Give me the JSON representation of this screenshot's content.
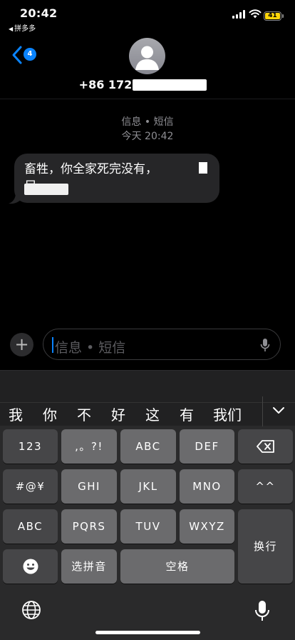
{
  "status_bar": {
    "time": "20:42",
    "back_app": "拼多多",
    "battery_level": "41",
    "battery_color": "#ffd60a"
  },
  "header": {
    "back_badge_count": "4",
    "contact_name": "+86 172"
  },
  "conversation": {
    "service_label": "信息 • 短信",
    "timestamp": "今天 20:42",
    "messages": [
      {
        "direction": "incoming",
        "text_line1": "畜牲，你全家死完没有，",
        "text_line2": "尸"
      }
    ]
  },
  "composer": {
    "placeholder": "信息 • 短信"
  },
  "keyboard": {
    "candidates": [
      "我",
      "你",
      "不",
      "好",
      "这",
      "有",
      "我们"
    ],
    "rows": [
      [
        "123",
        ",。?!",
        "ABC",
        "DEF"
      ],
      [
        "#@¥",
        "GHI",
        "JKL",
        "MNO",
        "^^"
      ],
      [
        "ABC",
        "PQRS",
        "TUV",
        "WXYZ"
      ],
      [
        "选拼音",
        "空格"
      ]
    ],
    "return_label": "换行"
  },
  "colors": {
    "accent": "#0a84ff",
    "bubble_incoming": "#262628",
    "key_light": "#6b6b6d",
    "key_dark": "#464648"
  }
}
